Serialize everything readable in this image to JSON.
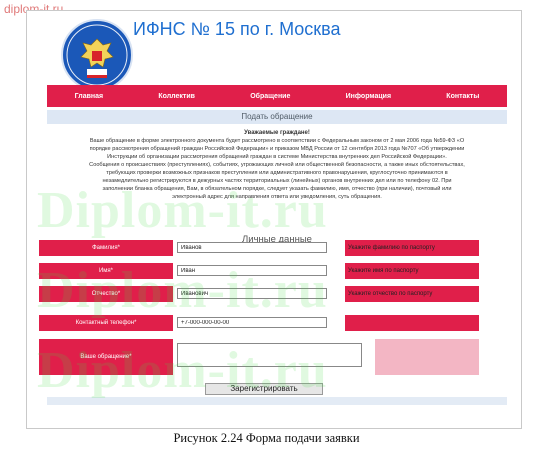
{
  "site_mark": "diplom-it.ru",
  "header": {
    "title": "ИФНС № 15 по г. Москва",
    "logo_text": "ФЕДЕРАЛЬНАЯ НАЛОГОВАЯ СЛУЖБА"
  },
  "nav": {
    "items": [
      {
        "label": "Главная"
      },
      {
        "label": "Коллектив"
      },
      {
        "label": "Обращение"
      },
      {
        "label": "Информация"
      },
      {
        "label": "Контакты"
      }
    ]
  },
  "section_title": "Подать обращение",
  "notice": {
    "greeting": "Уважаемые граждане!",
    "lines": [
      "Ваше обращение в форме электронного документа будет рассмотрено в соответствии с Федеральным законом от 2 мая 2006 года №59-ФЗ «О",
      "порядке рассмотрения обращений граждан Российской Федерации» и приказом МВД России от 12 сентября 2013 года №707 «Об утверждении",
      "Инструкции об организации рассмотрения обращений граждан в системе Министерства внутренних дел Российской Федерации».",
      "Сообщения о происшествиях (преступлениях), событиях, угрожающих личной или общественной безопасности, а также иных обстоятельствах,",
      "требующих проверки возможных признаков преступления или административного правонарушения, круглосуточно принимаются в",
      "незамедлительно регистрируются в дежурных частях территориальных (линейных) органов внутренних дел или по телефону 02. При",
      "заполнении бланка обращения, Вам, в обязательном порядке, следует указать фамилию, имя, отчество (при наличии), почтовый или",
      "электронный адрес для направления ответа или уведомления, суть обращения."
    ]
  },
  "personal_title": "Личные данные",
  "form": {
    "surname_label": "Фамилия*",
    "surname_value": "Иванов",
    "surname_hint": "Укажите фамилию по паспорту",
    "name_label": "Имя*",
    "name_value": "Иван",
    "name_hint": "Укажите имя по паспорту",
    "patronymic_label": "Отчество*",
    "patronymic_value": "Иванович",
    "patronymic_hint": "Укажите отчество по паспорту",
    "phone_label": "Контактный телефон*",
    "phone_value": "+7-000-000-00-00",
    "message_label": "Ваше обращение*",
    "message_value": ""
  },
  "submit_label": "Зарегистрировать",
  "watermark": "Diplom-it.ru",
  "caption": "Рисунок 2.24 Форма подачи заявки",
  "colors": {
    "accent_red": "#e01f4a",
    "title_blue": "#1f6fd0",
    "watermark_green": "#3cdc3c"
  }
}
